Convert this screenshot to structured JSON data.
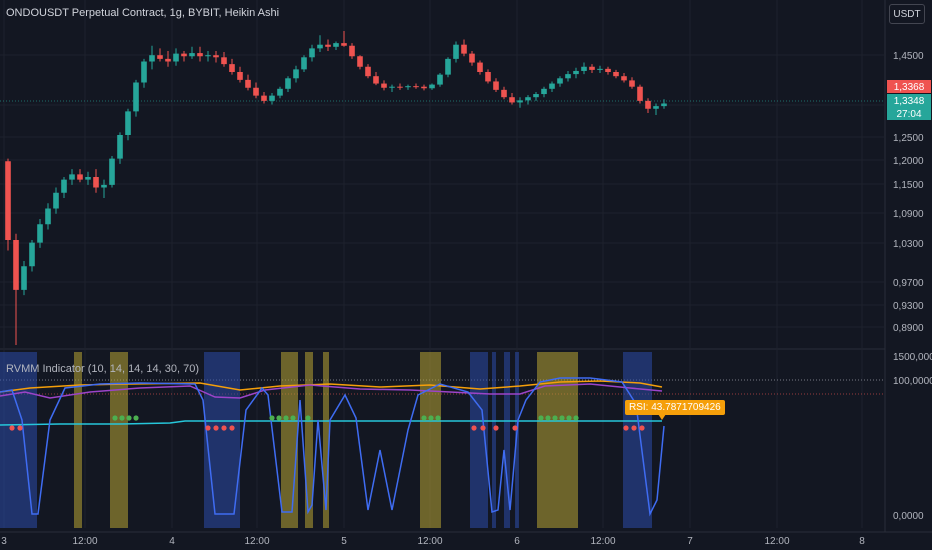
{
  "header": {
    "symbol_line": "ONDOUSDT Perpetual Contract, 1g, BYBIT, Heikin Ashi",
    "currency_button": "USDT"
  },
  "indicator": {
    "title": "RVMM Indicator (10, 14, 14, 14, 30, 70)",
    "rsi_label": "RSI: 43.7871709426"
  },
  "price_axis": {
    "ticks": [
      "1,4500",
      "1,3500",
      "1,2500",
      "1,2000",
      "1,1500",
      "1,0900",
      "1,0300",
      "0,9700",
      "0,9300",
      "0,8900"
    ],
    "last_price_red": "1,3368",
    "last_price_green": "1,3348",
    "countdown": "27:04"
  },
  "indicator_axis": {
    "ticks": [
      "1500,0000",
      "100,0000",
      "0,0000"
    ]
  },
  "time_axis": {
    "ticks": [
      "3",
      "12:00",
      "4",
      "12:00",
      "5",
      "12:00",
      "6",
      "12:00",
      "7",
      "12:00",
      "8"
    ]
  },
  "colors": {
    "background": "#131722",
    "up": "#26a69a",
    "down": "#ef5350",
    "yellow_band": "#b8a433",
    "blue_band": "#2b4aa8",
    "blue_line": "#3f6cf2",
    "cyan_line": "#26c6da",
    "orange_line": "#f59f0a",
    "purple_line": "#9c44c9",
    "rsi_label_bg": "#f59f0a"
  },
  "chart_data": {
    "type": "candlestick",
    "style": "Heikin Ashi",
    "symbol": "ONDOUSDT",
    "interval": "1g",
    "exchange": "BYBIT",
    "ohlc": [
      [
        1.23,
        1.235,
        1.06,
        1.08
      ],
      [
        1.08,
        1.092,
        0.88,
        0.985
      ],
      [
        0.985,
        1.04,
        0.975,
        1.03
      ],
      [
        1.03,
        1.08,
        1.02,
        1.075
      ],
      [
        1.075,
        1.12,
        1.065,
        1.11
      ],
      [
        1.11,
        1.15,
        1.1,
        1.14
      ],
      [
        1.14,
        1.18,
        1.13,
        1.17
      ],
      [
        1.17,
        1.2,
        1.16,
        1.195
      ],
      [
        1.195,
        1.215,
        1.185,
        1.205
      ],
      [
        1.205,
        1.215,
        1.19,
        1.195
      ],
      [
        1.195,
        1.21,
        1.185,
        1.2
      ],
      [
        1.2,
        1.215,
        1.17,
        1.18
      ],
      [
        1.18,
        1.195,
        1.16,
        1.185
      ],
      [
        1.185,
        1.24,
        1.18,
        1.235
      ],
      [
        1.235,
        1.285,
        1.225,
        1.28
      ],
      [
        1.28,
        1.33,
        1.27,
        1.325
      ],
      [
        1.325,
        1.385,
        1.315,
        1.38
      ],
      [
        1.38,
        1.425,
        1.37,
        1.42
      ],
      [
        1.42,
        1.45,
        1.405,
        1.432
      ],
      [
        1.432,
        1.445,
        1.42,
        1.425
      ],
      [
        1.425,
        1.44,
        1.41,
        1.42
      ],
      [
        1.42,
        1.445,
        1.412,
        1.435
      ],
      [
        1.435,
        1.44,
        1.42,
        1.43
      ],
      [
        1.43,
        1.448,
        1.425,
        1.436
      ],
      [
        1.436,
        1.448,
        1.42,
        1.43
      ],
      [
        1.43,
        1.44,
        1.42,
        1.432
      ],
      [
        1.432,
        1.44,
        1.418,
        1.428
      ],
      [
        1.428,
        1.438,
        1.41,
        1.415
      ],
      [
        1.415,
        1.425,
        1.395,
        1.4
      ],
      [
        1.4,
        1.41,
        1.38,
        1.385
      ],
      [
        1.385,
        1.395,
        1.365,
        1.37
      ],
      [
        1.37,
        1.38,
        1.35,
        1.355
      ],
      [
        1.355,
        1.362,
        1.34,
        1.345
      ],
      [
        1.345,
        1.36,
        1.338,
        1.355
      ],
      [
        1.355,
        1.372,
        1.35,
        1.368
      ],
      [
        1.368,
        1.392,
        1.362,
        1.388
      ],
      [
        1.388,
        1.412,
        1.38,
        1.405
      ],
      [
        1.405,
        1.432,
        1.4,
        1.428
      ],
      [
        1.428,
        1.452,
        1.42,
        1.445
      ],
      [
        1.445,
        1.47,
        1.438,
        1.452
      ],
      [
        1.452,
        1.462,
        1.44,
        1.448
      ],
      [
        1.448,
        1.458,
        1.442,
        1.455
      ],
      [
        1.455,
        1.478,
        1.448,
        1.45
      ],
      [
        1.45,
        1.455,
        1.425,
        1.43
      ],
      [
        1.43,
        1.432,
        1.405,
        1.41
      ],
      [
        1.41,
        1.415,
        1.388,
        1.392
      ],
      [
        1.392,
        1.4,
        1.375,
        1.378
      ],
      [
        1.378,
        1.384,
        1.365,
        1.37
      ],
      [
        1.37,
        1.376,
        1.362,
        1.372
      ],
      [
        1.372,
        1.378,
        1.366,
        1.371
      ],
      [
        1.371,
        1.376,
        1.366,
        1.373
      ],
      [
        1.373,
        1.378,
        1.368,
        1.372
      ],
      [
        1.372,
        1.376,
        1.365,
        1.369
      ],
      [
        1.369,
        1.378,
        1.366,
        1.376
      ],
      [
        1.376,
        1.398,
        1.372,
        1.395
      ],
      [
        1.395,
        1.428,
        1.39,
        1.425
      ],
      [
        1.425,
        1.458,
        1.418,
        1.452
      ],
      [
        1.452,
        1.462,
        1.43,
        1.435
      ],
      [
        1.435,
        1.44,
        1.412,
        1.418
      ],
      [
        1.418,
        1.422,
        1.395,
        1.4
      ],
      [
        1.4,
        1.405,
        1.378,
        1.382
      ],
      [
        1.382,
        1.388,
        1.362,
        1.366
      ],
      [
        1.366,
        1.372,
        1.348,
        1.352
      ],
      [
        1.352,
        1.36,
        1.338,
        1.342
      ],
      [
        1.342,
        1.352,
        1.332,
        1.346
      ],
      [
        1.346,
        1.356,
        1.338,
        1.352
      ],
      [
        1.352,
        1.362,
        1.345,
        1.358
      ],
      [
        1.358,
        1.372,
        1.352,
        1.368
      ],
      [
        1.368,
        1.382,
        1.362,
        1.378
      ],
      [
        1.378,
        1.392,
        1.372,
        1.388
      ],
      [
        1.388,
        1.402,
        1.382,
        1.396
      ],
      [
        1.396,
        1.408,
        1.388,
        1.402
      ],
      [
        1.402,
        1.418,
        1.396,
        1.41
      ],
      [
        1.41,
        1.415,
        1.398,
        1.404
      ],
      [
        1.404,
        1.412,
        1.398,
        1.406
      ],
      [
        1.406,
        1.41,
        1.395,
        1.4
      ],
      [
        1.4,
        1.404,
        1.388,
        1.392
      ],
      [
        1.392,
        1.398,
        1.38,
        1.384
      ],
      [
        1.384,
        1.39,
        1.368,
        1.372
      ],
      [
        1.372,
        1.376,
        1.34,
        1.345
      ],
      [
        1.345,
        1.35,
        1.322,
        1.33
      ],
      [
        1.33,
        1.34,
        1.318,
        1.335
      ],
      [
        1.335,
        1.348,
        1.33,
        1.34
      ]
    ],
    "indicator_series": {
      "rsi_last": 43.7871709426,
      "levels": [
        30,
        70
      ]
    },
    "ylim": [
      0.88,
      1.48
    ]
  }
}
